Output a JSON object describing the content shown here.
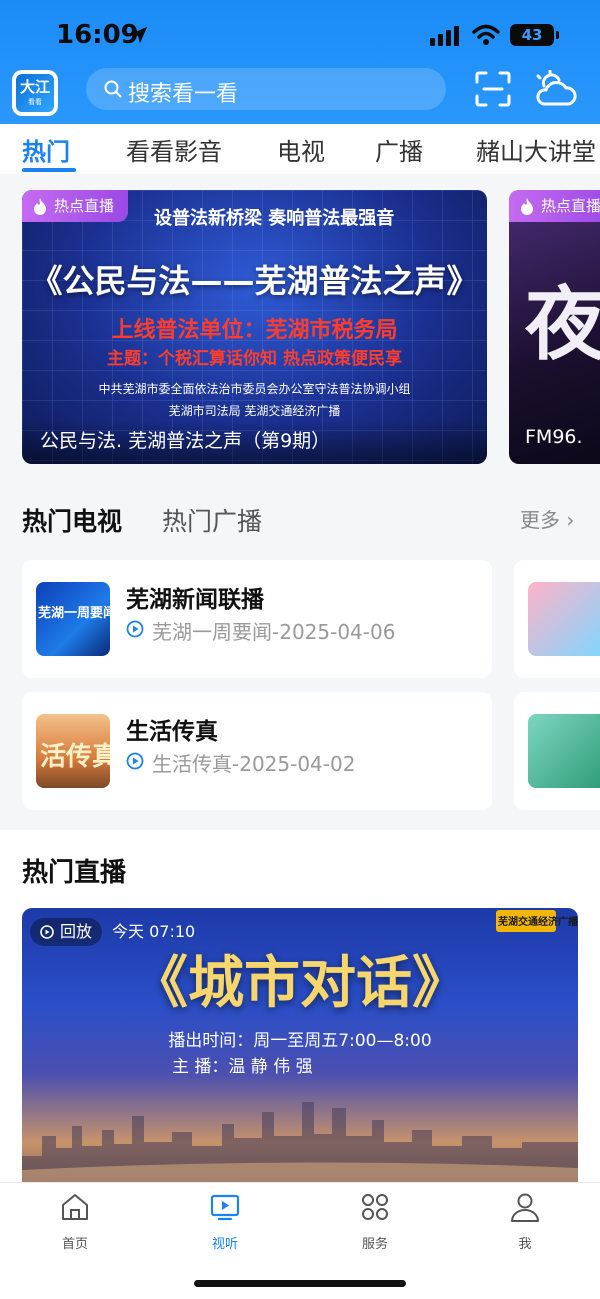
{
  "status_bar": {
    "time": "16:09",
    "battery": "43"
  },
  "header": {
    "logo_text": "大江",
    "logo_subtext": "看看",
    "search_placeholder": "搜索看一看",
    "icons": [
      "scan-icon",
      "weather-icon"
    ]
  },
  "tabs": [
    {
      "label": "热门",
      "active": true
    },
    {
      "label": "看看影音"
    },
    {
      "label": "电视"
    },
    {
      "label": "广播"
    },
    {
      "label": "赭山大讲堂"
    }
  ],
  "banners": [
    {
      "badge": "热点直播",
      "top_line": "设普法新桥梁  奏响普法最强音",
      "main_title": "《公民与法——芜湖普法之声》",
      "unit_line": "上线普法单位：芜湖市税务局",
      "topic_line": "主题：个税汇算话你知 热点政策便民享",
      "org_line1": "中共芜湖市委全面依法治市委员会办公室守法普法协调小组",
      "org_line2": "芜湖市司法局      芜湖交通经济广播",
      "caption": "公民与法. 芜湖普法之声（第9期）"
    },
    {
      "badge": "热点直播",
      "big_char": "夜",
      "caption": "FM96."
    }
  ],
  "hot_section": {
    "tab_active": "热门电视",
    "tab_inactive": "热门广播",
    "more_label": "更多 ›",
    "items": [
      {
        "title": "芜湖新闻联播",
        "subtitle": "芜湖一周要闻-2025-04-06",
        "thumb_text": "芜湖一周要闻"
      },
      {
        "title": "生活传真",
        "subtitle": "生活传真-2025-04-02",
        "thumb_text": "活传真"
      }
    ]
  },
  "live_section": {
    "title": "热门直播",
    "replay_label": "回放",
    "time_label": "今天  07:10",
    "station_logo": "芜湖交通经济广播",
    "main_title": "《城市对话》",
    "schedule": "播出时间：周一至周五7:00—8:00",
    "hosts": "主      播：温  静    伟  强"
  },
  "bottom_nav": [
    {
      "label": "首页",
      "icon": "home-icon"
    },
    {
      "label": "视听",
      "icon": "play-screen-icon",
      "active": true
    },
    {
      "label": "服务",
      "icon": "grid-icon"
    },
    {
      "label": "我",
      "icon": "user-icon"
    }
  ],
  "colors": {
    "accent": "#1a82f2",
    "header_bg": "#1b8cf7",
    "badge_purple": "#b05cec"
  }
}
